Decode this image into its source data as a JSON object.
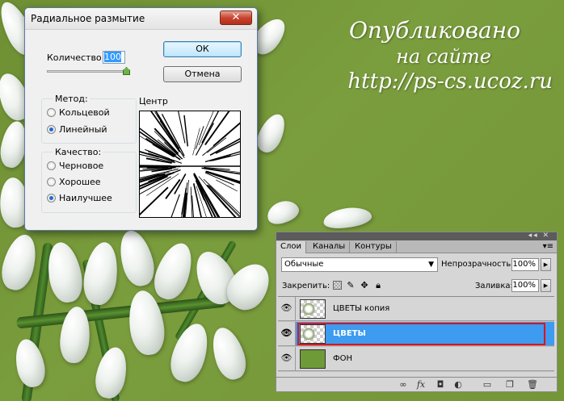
{
  "watermark": {
    "line1": "Опубликовано",
    "line2": "на сайте",
    "line3": "http://ps-cs.ucoz.ru"
  },
  "dialog": {
    "title": "Радиальное размытие",
    "close_label": "✕",
    "amount_label": "Количество",
    "amount_value": "100",
    "amount_fraction": 1.0,
    "ok_label": "ОК",
    "cancel_label": "Отмена",
    "method_legend": "Метод:",
    "method_options": [
      {
        "label": "Кольцевой",
        "selected": false
      },
      {
        "label": "Линейный",
        "selected": true
      }
    ],
    "quality_legend": "Качество:",
    "quality_options": [
      {
        "label": "Черновое",
        "selected": false
      },
      {
        "label": "Хорошее",
        "selected": false
      },
      {
        "label": "Наилучшее",
        "selected": true
      }
    ],
    "center_label": "Центр"
  },
  "layers_panel": {
    "tabs": [
      {
        "label": "Слои",
        "active": true
      },
      {
        "label": "Каналы",
        "active": false
      },
      {
        "label": "Контуры",
        "active": false
      }
    ],
    "blend_mode": "Обычные",
    "opacity_label": "Непрозрачность:",
    "opacity_value": "100%",
    "lock_label": "Закрепить:",
    "fill_label": "Заливка:",
    "fill_value": "100%",
    "layers": [
      {
        "name": "ЦВЕТЫ копия",
        "visible": true,
        "selected": false,
        "thumb": "flower-transparent"
      },
      {
        "name": "ЦВЕТЫ",
        "visible": true,
        "selected": true,
        "thumb": "flower-transparent"
      },
      {
        "name": "ФОН",
        "visible": true,
        "selected": false,
        "thumb": "solid-green"
      }
    ],
    "footer_icons": [
      "link-icon",
      "fx-icon",
      "mask-icon",
      "adjustment-icon",
      "group-icon",
      "new-layer-icon",
      "trash-icon"
    ]
  },
  "colors": {
    "background_green": "#7a9a3a",
    "selection_blue": "#3d9bf0",
    "highlight_red": "#e0121a"
  }
}
